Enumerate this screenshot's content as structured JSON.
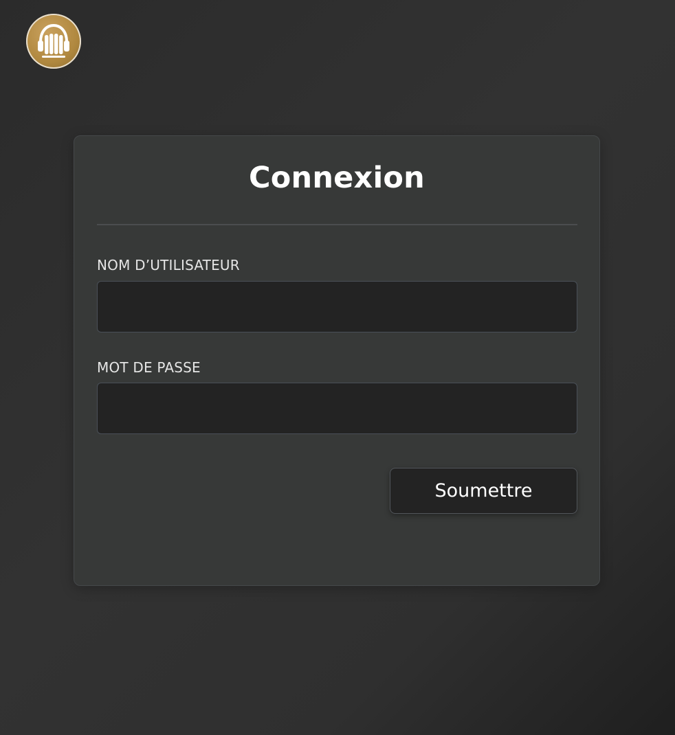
{
  "branding": {
    "logo_icon": "headphones-books-icon",
    "accent_color": "#b0883f"
  },
  "login": {
    "title": "Connexion",
    "username_label": "NOM D’UTILISATEUR",
    "username_value": "",
    "password_label": "MOT DE PASSE",
    "password_value": "",
    "submit_label": "Soumettre"
  }
}
